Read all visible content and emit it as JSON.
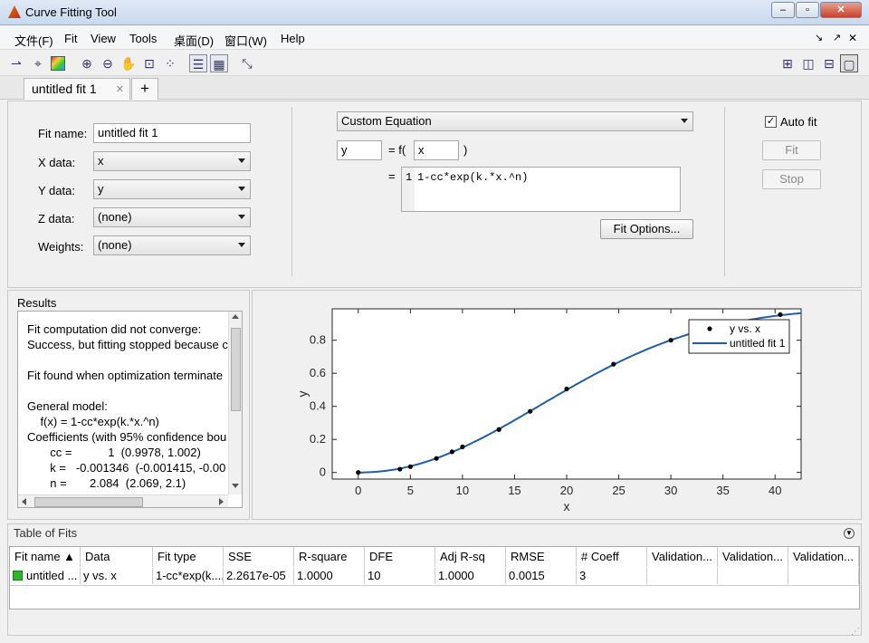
{
  "window": {
    "title": "Curve Fitting Tool",
    "min_label": "–",
    "max_label": "▫",
    "close_label": "✕"
  },
  "menu": {
    "items": [
      "文件(F)",
      "Fit",
      "View",
      "Tools",
      "桌面(D)",
      "窗口(W)",
      "Help"
    ]
  },
  "tabs": {
    "active_label": "untitled fit 1",
    "close_glyph": "✕",
    "add_glyph": "+"
  },
  "fit_form": {
    "fit_name_label": "Fit name:",
    "fit_name_value": "untitled fit 1",
    "xdata_label": "X data:",
    "xdata_value": "x",
    "ydata_label": "Y data:",
    "ydata_value": "y",
    "zdata_label": "Z data:",
    "zdata_value": "(none)",
    "weights_label": "Weights:",
    "weights_value": "(none)"
  },
  "equation": {
    "type_value": "Custom Equation",
    "lhs_value": "y",
    "f_label": "= f(",
    "indep_value": "x",
    "close_paren": ")",
    "equals_label": "=",
    "line_no": "1",
    "expression": "1-cc*exp(k.*x.^n)",
    "fit_options_label": "Fit Options..."
  },
  "controls": {
    "auto_fit_label": "Auto fit",
    "auto_fit_checked": true,
    "fit_label": "Fit",
    "stop_label": "Stop"
  },
  "results": {
    "title": "Results",
    "lines": [
      "Fit computation did not converge:",
      "Success, but fitting stopped because c",
      "",
      "Fit found when optimization terminate",
      "",
      "General model:",
      "    f(x) = 1-cc*exp(k.*x.^n)",
      "Coefficients (with 95% confidence bou",
      "       cc =           1  (0.9978, 1.002)",
      "       k =   -0.001346  (-0.001415, -0.00",
      "       n =       2.084  (2.069, 2.1)"
    ]
  },
  "chart_data": {
    "type": "line",
    "xlabel": "x",
    "ylabel": "y",
    "xlim": [
      -2.5,
      42.5
    ],
    "ylim": [
      -0.04,
      0.99
    ],
    "xticks": [
      0,
      5,
      10,
      15,
      20,
      25,
      30,
      35,
      40
    ],
    "yticks": [
      0,
      0.2,
      0.4,
      0.6,
      0.8
    ],
    "ytick_labels": [
      "0",
      "0.2",
      "0.4",
      "0.6",
      "0.8"
    ],
    "legend_position": "top-right",
    "series": [
      {
        "name": "y vs. x",
        "kind": "scatter",
        "color": "#000000",
        "x": [
          0,
          4,
          5,
          7.5,
          9,
          10,
          13.5,
          16.5,
          20,
          24.5,
          30,
          40.5
        ],
        "y": [
          0,
          0.02,
          0.035,
          0.085,
          0.125,
          0.155,
          0.26,
          0.37,
          0.505,
          0.655,
          0.8,
          0.955
        ]
      },
      {
        "name": "untitled fit 1",
        "kind": "line",
        "color": "#1f5fa8",
        "model": {
          "cc": 1,
          "k": -0.001346,
          "n": 2.084
        }
      }
    ]
  },
  "table": {
    "title": "Table of Fits",
    "columns": [
      "Fit name ▲",
      "Data",
      "Fit type",
      "SSE",
      "R-square",
      "DFE",
      "Adj R-sq",
      "RMSE",
      "# Coeff",
      "Validation...",
      "Validation...",
      "Validation..."
    ],
    "rows": [
      [
        "untitled ...",
        "y vs. x",
        "1-cc*exp(k....",
        "2.2617e-05",
        "1.0000",
        "10",
        "1.0000",
        "0.0015",
        "3",
        "",
        "",
        ""
      ]
    ],
    "status_color": "#2db52d"
  },
  "colors": {
    "accent": "#1f5fa8",
    "titlebar": "#c9d9ee"
  }
}
